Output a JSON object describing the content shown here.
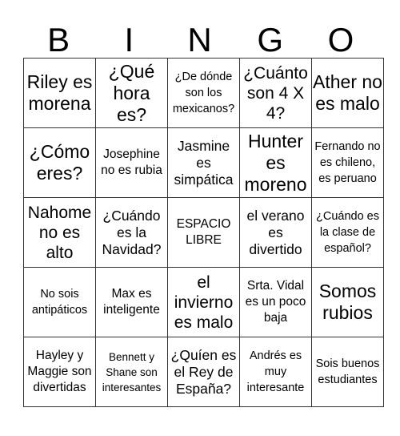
{
  "header": [
    "B",
    "I",
    "N",
    "G",
    "O"
  ],
  "grid": [
    [
      "Riley es morena",
      "¿Qué hora es?",
      "¿De dónde son los mexicanos?",
      "¿Cuánto son 4 X 4?",
      "Ather no es malo"
    ],
    [
      "¿Cómo eres?",
      "Josephine no es rubia",
      "Jasmine es simpática",
      "Hunter es moreno",
      "Fernando no es chileno, es peruano"
    ],
    [
      "Nahome no es alto",
      "¿Cuándo es la Navidad?",
      "ESPACIO LIBRE",
      "el verano es divertido",
      "¿Cuándo es la clase de español?"
    ],
    [
      "No sois antipáticos",
      "Max es inteligente",
      "el invierno es malo",
      "Srta. Vidal es un poco baja",
      "Somos rubios"
    ],
    [
      "Hayley y Maggie son divertidas",
      "Bennett y Shane son interesantes",
      "¿Quíen es el Rey de España?",
      "Andrés es muy interesante",
      "Sois buenos estudiantes"
    ]
  ]
}
